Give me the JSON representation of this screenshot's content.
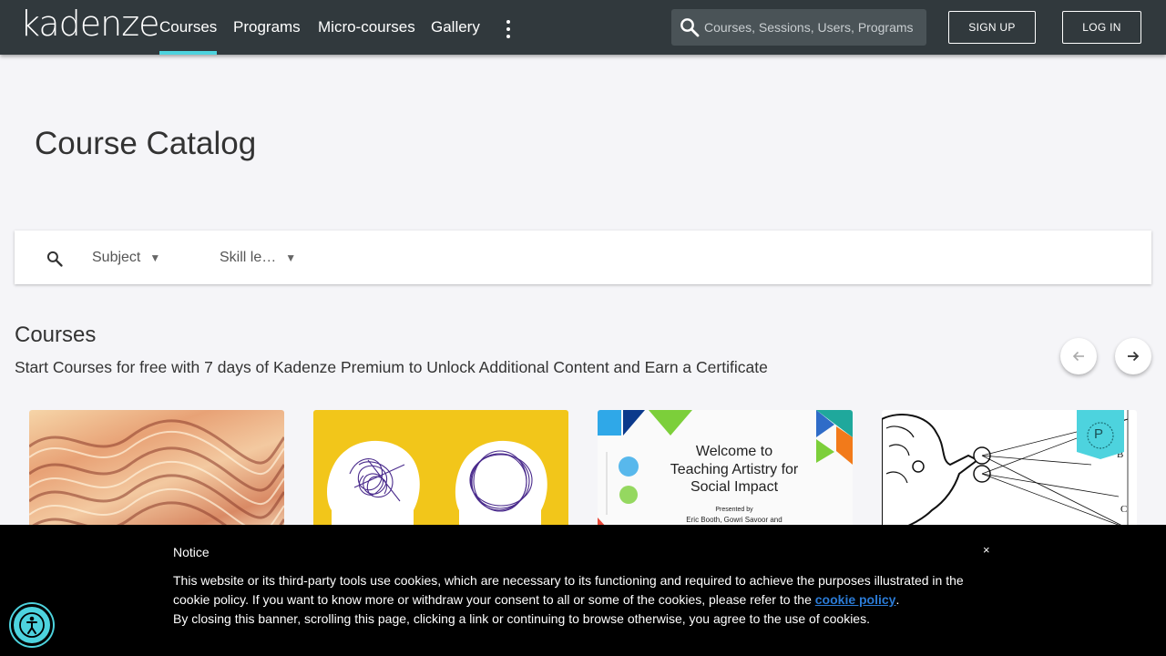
{
  "header": {
    "logo": "kadenze",
    "nav": [
      {
        "label": "Courses",
        "active": true
      },
      {
        "label": "Programs",
        "active": false
      },
      {
        "label": "Micro-courses",
        "active": false
      },
      {
        "label": "Gallery",
        "active": false
      }
    ],
    "more_icon": "more-vertical-icon",
    "search_placeholder": "Courses, Sessions, Users, Programs",
    "signup_label": "SIGN UP",
    "login_label": "LOG IN",
    "accent": "#4dd3de",
    "bg": "#31393d"
  },
  "page": {
    "title": "Course Catalog"
  },
  "filters": {
    "subject": "Subject",
    "skill_level": "Skill le…"
  },
  "courses": {
    "title": "Courses",
    "subtitle": "Start Courses for free with 7 days of Kadenze Premium to Unlock Additional Content and Earn a Certificate",
    "cards": [
      {
        "image": "abstract-waves"
      },
      {
        "image": "two-heads-scribbles"
      },
      {
        "image": "teaching-artistry-slide",
        "slide_title": "Welcome to Teaching Artistry for Social Impact",
        "slide_presented": "Presented by",
        "slide_names": "Eric Booth, Gowri Savoor and"
      },
      {
        "image": "vintage-optics-engraving",
        "badge": "P"
      }
    ]
  },
  "cookie": {
    "notice": "Notice",
    "close": "×",
    "text1": "This website or its third-party tools use cookies, which are necessary to its functioning and required to achieve the purposes illustrated in the cookie policy. If you want to know more or withdraw your consent to all or some of the cookies, please refer to the",
    "link": "cookie policy",
    "text2": ".",
    "text3": "By closing this banner, scrolling this page, clicking a link or continuing to browse otherwise, you agree to the use of cookies."
  }
}
